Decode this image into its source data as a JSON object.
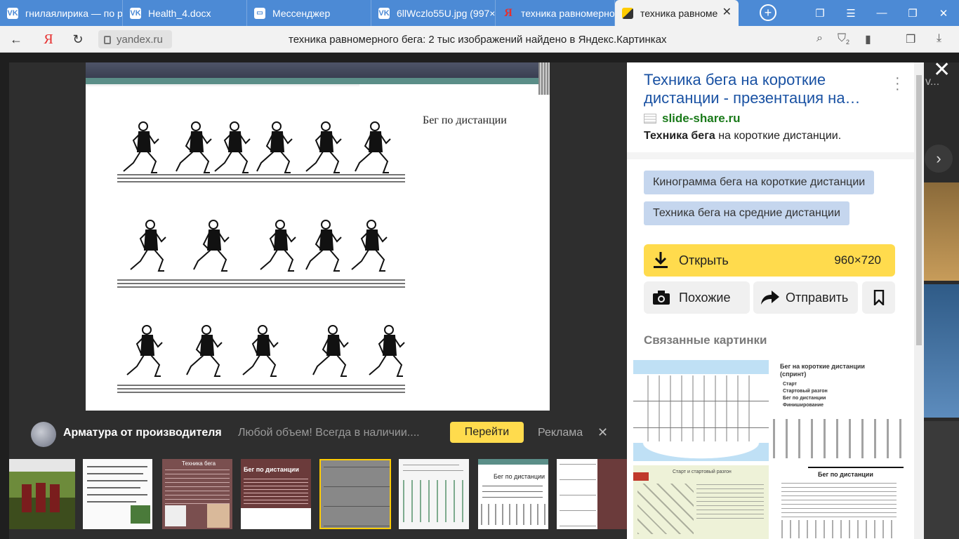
{
  "tabs": [
    {
      "label": "гнилаялирика — по р",
      "favicon": "vk-icon"
    },
    {
      "label": "Health_4.docx",
      "favicon": "vk-icon"
    },
    {
      "label": "Мессенджер",
      "favicon": "messenger-icon"
    },
    {
      "label": "6llWczlo55U.jpg (997×",
      "favicon": "vk-icon"
    },
    {
      "label": "техника равномерно",
      "favicon": "yandex-icon"
    },
    {
      "label": "техника равноме",
      "favicon": "yandex-images-icon",
      "active": true
    }
  ],
  "address": {
    "domain": "yandex.ru",
    "page_title": "техника равномерного бега: 2 тыс изображений найдено в Яндекс.Картинках",
    "downloads_badge": "2"
  },
  "image": {
    "caption": "Бег по дистанции"
  },
  "ad": {
    "title": "Арматура от производителя",
    "text": "Любой объем! Всегда в наличии....",
    "button": "Перейти",
    "label": "Реклама"
  },
  "thumbnails": [
    {
      "id": "t1"
    },
    {
      "id": "t2"
    },
    {
      "id": "t3",
      "label": "Техника бега"
    },
    {
      "id": "t4",
      "label": "Бег по дистанции"
    },
    {
      "id": "t5",
      "selected": true
    },
    {
      "id": "t6"
    },
    {
      "id": "t7",
      "label": "Бег по дистанции"
    },
    {
      "id": "t8"
    }
  ],
  "panel": {
    "title": "Техника бега на короткие дистанции - презентация на…",
    "site": "slide-share.ru",
    "desc_bold": "Техника бега",
    "desc_rest": " на короткие дистанции.",
    "chips": [
      "Кинограмма бега на короткие дистанции",
      "Техника бега на средние дистанции"
    ],
    "open_label": "Открыть",
    "open_size": "960×720",
    "similar_label": "Похожие",
    "share_label": "Отправить",
    "related_title": "Связанные картинки",
    "related": [
      {
        "title": "Бег на короткие дистанции (спринт)",
        "items": [
          "Старт",
          "Стартовый разгон",
          "Бег по дистанции",
          "Финиширование"
        ]
      },
      {
        "title": "Старт и стартовый разгон"
      },
      {
        "title": "Бег по дистанции"
      }
    ]
  },
  "bg_text": "v..."
}
